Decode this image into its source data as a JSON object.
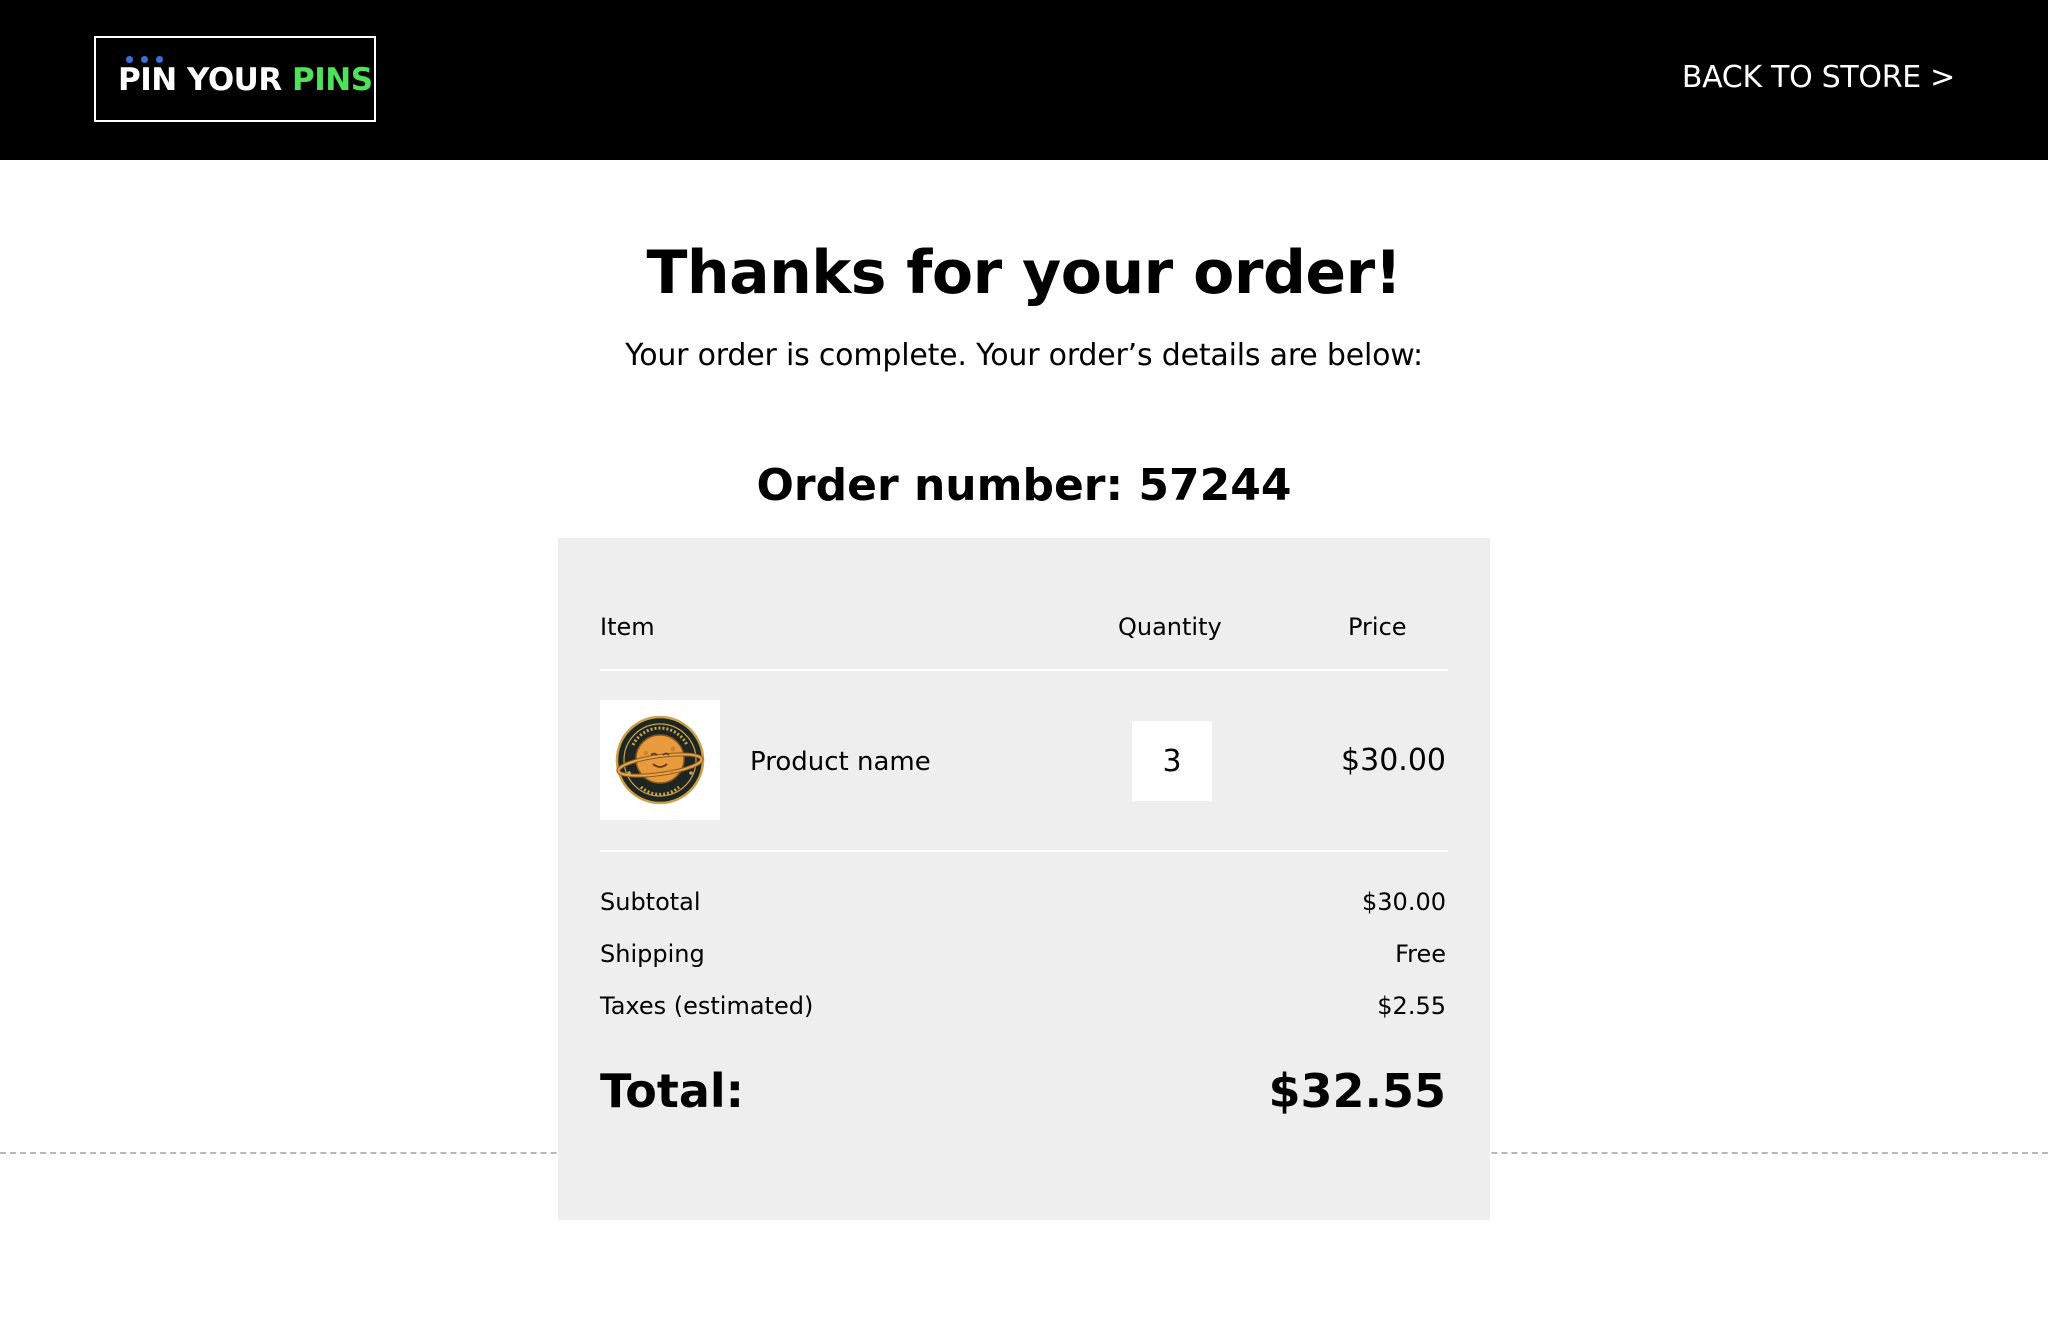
{
  "header": {
    "logo": {
      "part1": "PIN YOUR ",
      "part2": "PINS"
    },
    "back_link": "BACK TO STORE >"
  },
  "main": {
    "title": "Thanks for your order!",
    "subtitle": "Your order is complete. Your order’s details are below:",
    "order_number": "Order number: 57244"
  },
  "order": {
    "columns": {
      "item": "Item",
      "quantity": "Quantity",
      "price": "Price"
    },
    "items": [
      {
        "image_icon": "personal-space-pin-icon",
        "name": "Product name",
        "quantity": "3",
        "price": "$30.00"
      }
    ],
    "summary": {
      "subtotal_label": "Subtotal",
      "subtotal_value": "$30.00",
      "shipping_label": "Shipping",
      "shipping_value": "Free",
      "taxes_label": "Taxes (estimated)",
      "taxes_value": "$2.55",
      "total_label": "Total:",
      "total_value": "$32.55"
    }
  },
  "colors": {
    "header_bg": "#000000",
    "logo_accent": "#4ee25a",
    "logo_dots": "#3b6fd6",
    "card_bg": "#eeeeee"
  }
}
